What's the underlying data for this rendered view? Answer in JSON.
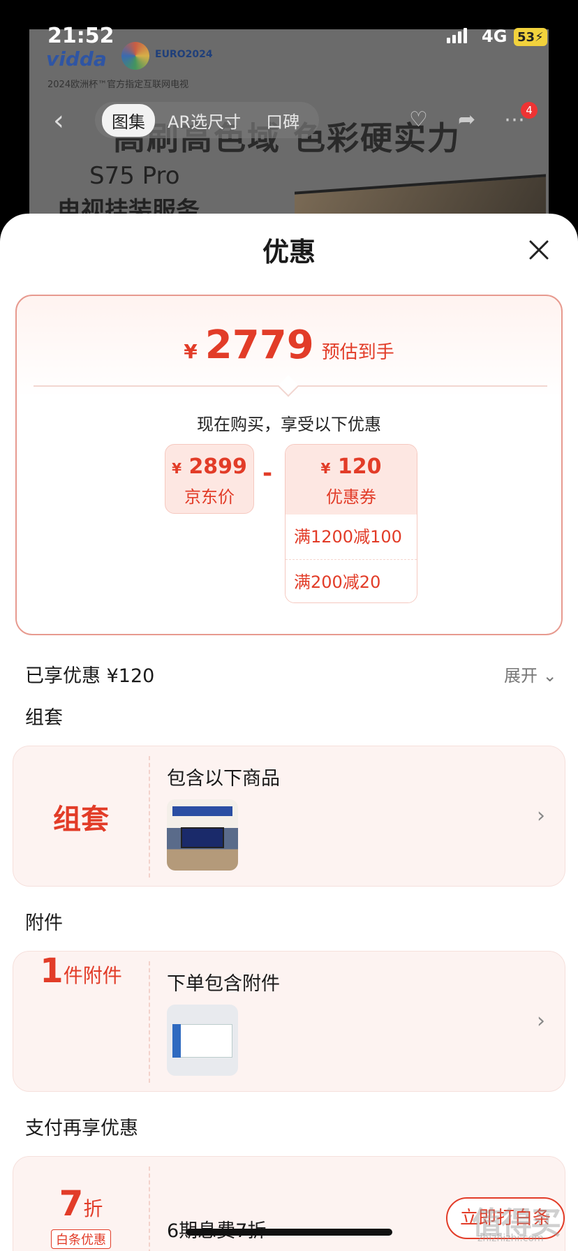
{
  "status_bar": {
    "time": "21:52",
    "network": "4G",
    "battery": "53"
  },
  "background": {
    "brand": "vidda",
    "euro_text": "EURO2024",
    "sub_caption": "2024欧洲杯™官方指定互联网电视",
    "headline": "高刷高色域 色彩硬实力",
    "model": "S75 Pro",
    "service": "电视挂装服务",
    "nav_tabs": [
      "图集",
      "AR选尺寸",
      "口碑"
    ],
    "cart_count": "4"
  },
  "sheet": {
    "title": "优惠",
    "price_card": {
      "currency": "¥",
      "final_price": "2779",
      "final_label": "预估到手",
      "intro": "现在购买，享受以下优惠",
      "jd_price": "2899",
      "jd_label": "京东价",
      "minus": "-",
      "coupon_amount": "120",
      "coupon_label": "优惠券",
      "coupon_rules": [
        "满1200减100",
        "满200减20"
      ]
    },
    "enjoyed": "已享优惠 ¥120",
    "expand": "展开",
    "sections": {
      "bundle": {
        "title": "组套",
        "left_label": "组套",
        "card_title": "包含以下商品"
      },
      "accessory": {
        "title": "附件",
        "count": "1",
        "count_unit": "件附件",
        "card_title": "下单包含附件"
      },
      "payment": {
        "title": "支付再享优惠",
        "discount": "7",
        "discount_unit": "折",
        "badge": "白条优惠",
        "card_title": "6期息费7折",
        "button": "立即打白条"
      }
    }
  },
  "watermark": {
    "main": "值得买",
    "sub": "zhizhizhi.com"
  },
  "colors": {
    "accent": "#e23c28",
    "card_bg": "#fdf3f1"
  }
}
